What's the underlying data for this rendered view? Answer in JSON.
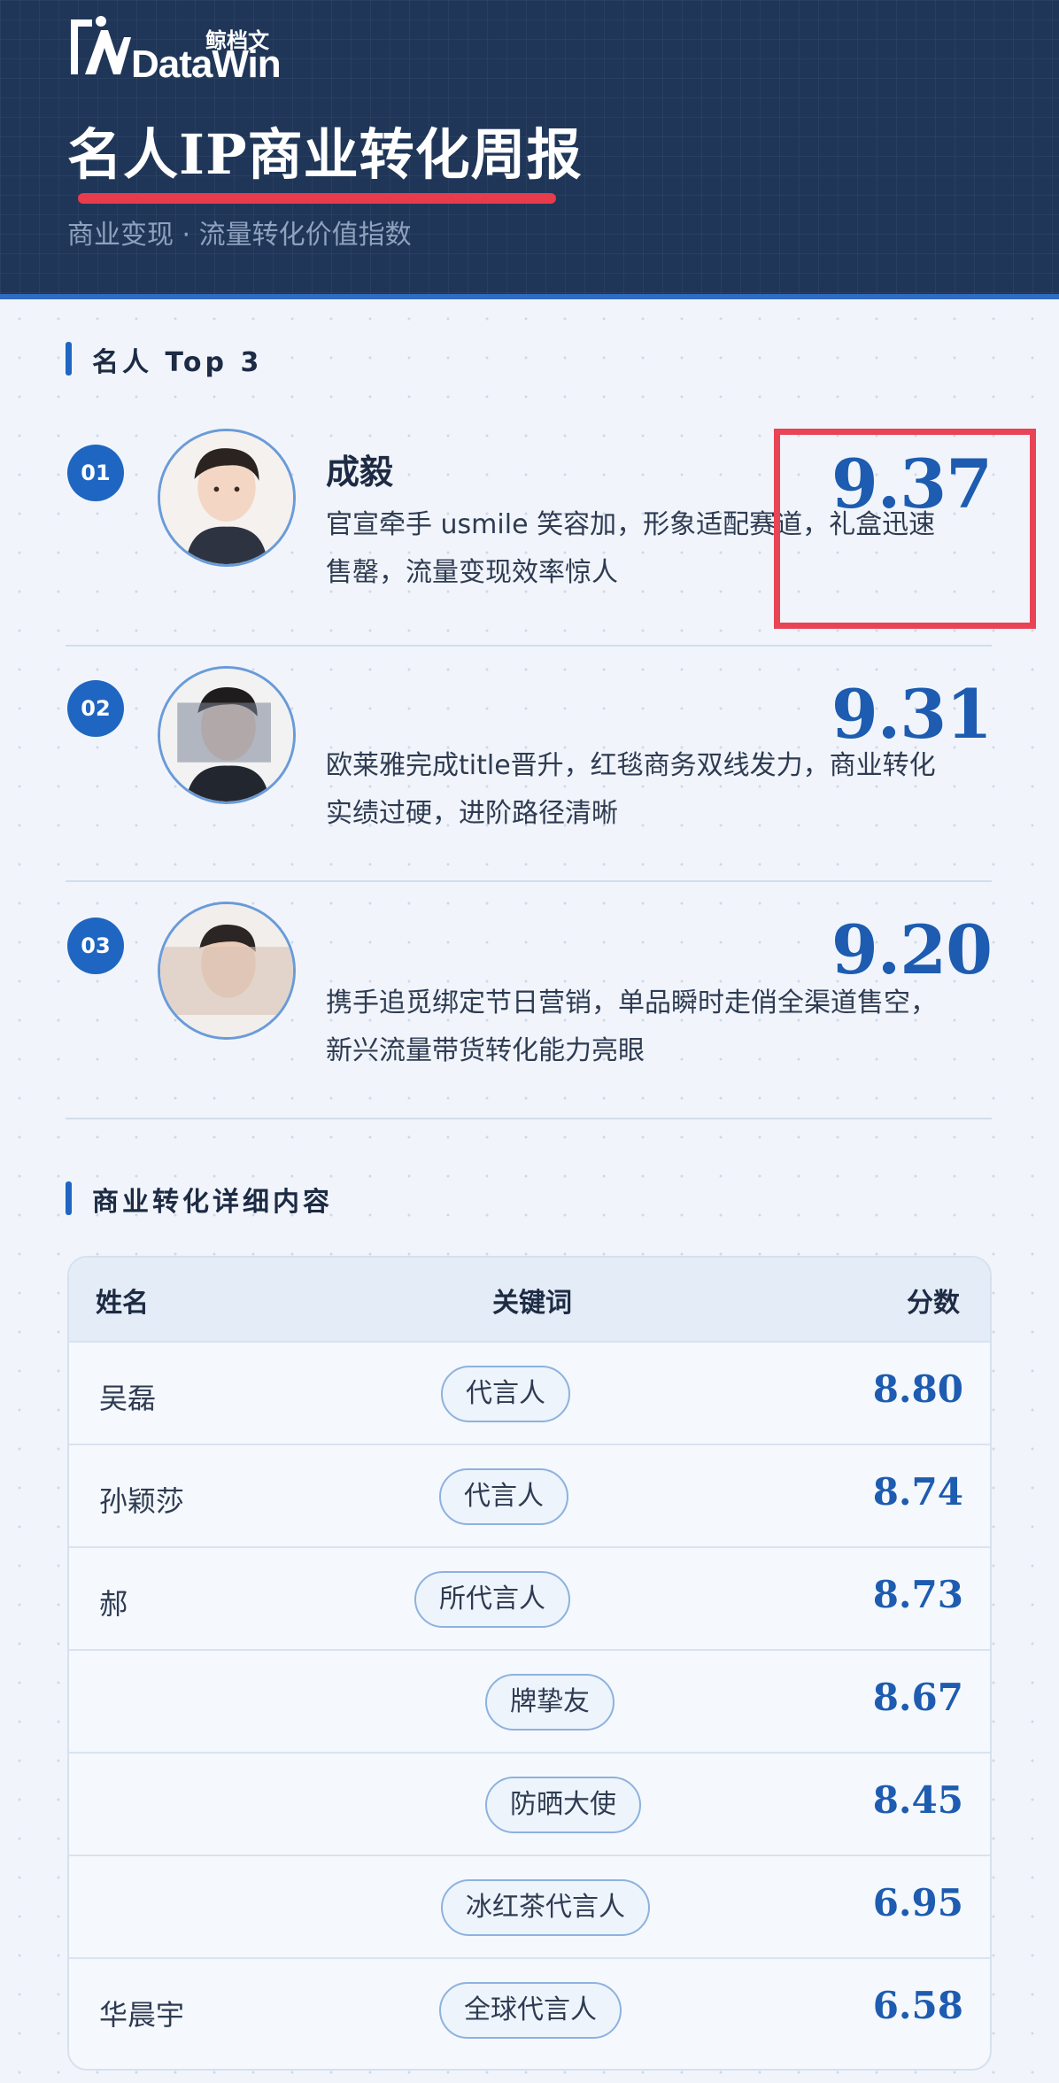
{
  "header": {
    "logo_cn": "鲸档文",
    "logo_en": "DataWin",
    "title": "名人IP商业转化周报",
    "subtitle": "商业变现 · 流量转化价值指数"
  },
  "top3": {
    "heading": "名人 Top 3",
    "items": [
      {
        "rank": "01",
        "name": "成毅",
        "desc_line1": "官宣牵手 usmile 笑容加，形象适配赛道，礼盒迅速",
        "desc_line2": "售罄，流量变现效率惊人",
        "score": "9.37"
      },
      {
        "rank": "02",
        "name": "",
        "desc_line1": "欧莱雅完成title晋升，红毯商务双线发力，商业转化",
        "desc_line2": "实绩过硬，进阶路径清晰",
        "score": "9.31"
      },
      {
        "rank": "03",
        "name": "",
        "desc_line1": "携手追觅绑定节日营销，单品瞬时走俏全渠道售空，",
        "desc_line2": "新兴流量带货转化能力亮眼",
        "score": "9.20"
      }
    ]
  },
  "details": {
    "heading": "商业转化详细内容",
    "columns": {
      "name": "姓名",
      "keyword": "关键词",
      "score": "分数"
    },
    "rows": [
      {
        "name": "吴磊",
        "keyword": "代言人",
        "score": "8.80"
      },
      {
        "name": "孙颖莎",
        "keyword": "代言人",
        "score": "8.74"
      },
      {
        "name": "郝",
        "keyword": "所代言人",
        "score": "8.73"
      },
      {
        "name": "",
        "keyword": "牌挚友",
        "score": "8.67"
      },
      {
        "name": "",
        "keyword": "防晒大使",
        "score": "8.45"
      },
      {
        "name": "",
        "keyword": "冰红茶代言人",
        "score": "6.95"
      },
      {
        "name": "华晨宇",
        "keyword": "全球代言人",
        "score": "6.58"
      }
    ]
  },
  "colors": {
    "header_bg": "#1f3658",
    "accent_blue": "#1f66c2",
    "score_blue": "#1d5cb0",
    "highlight_red": "#e84456"
  }
}
